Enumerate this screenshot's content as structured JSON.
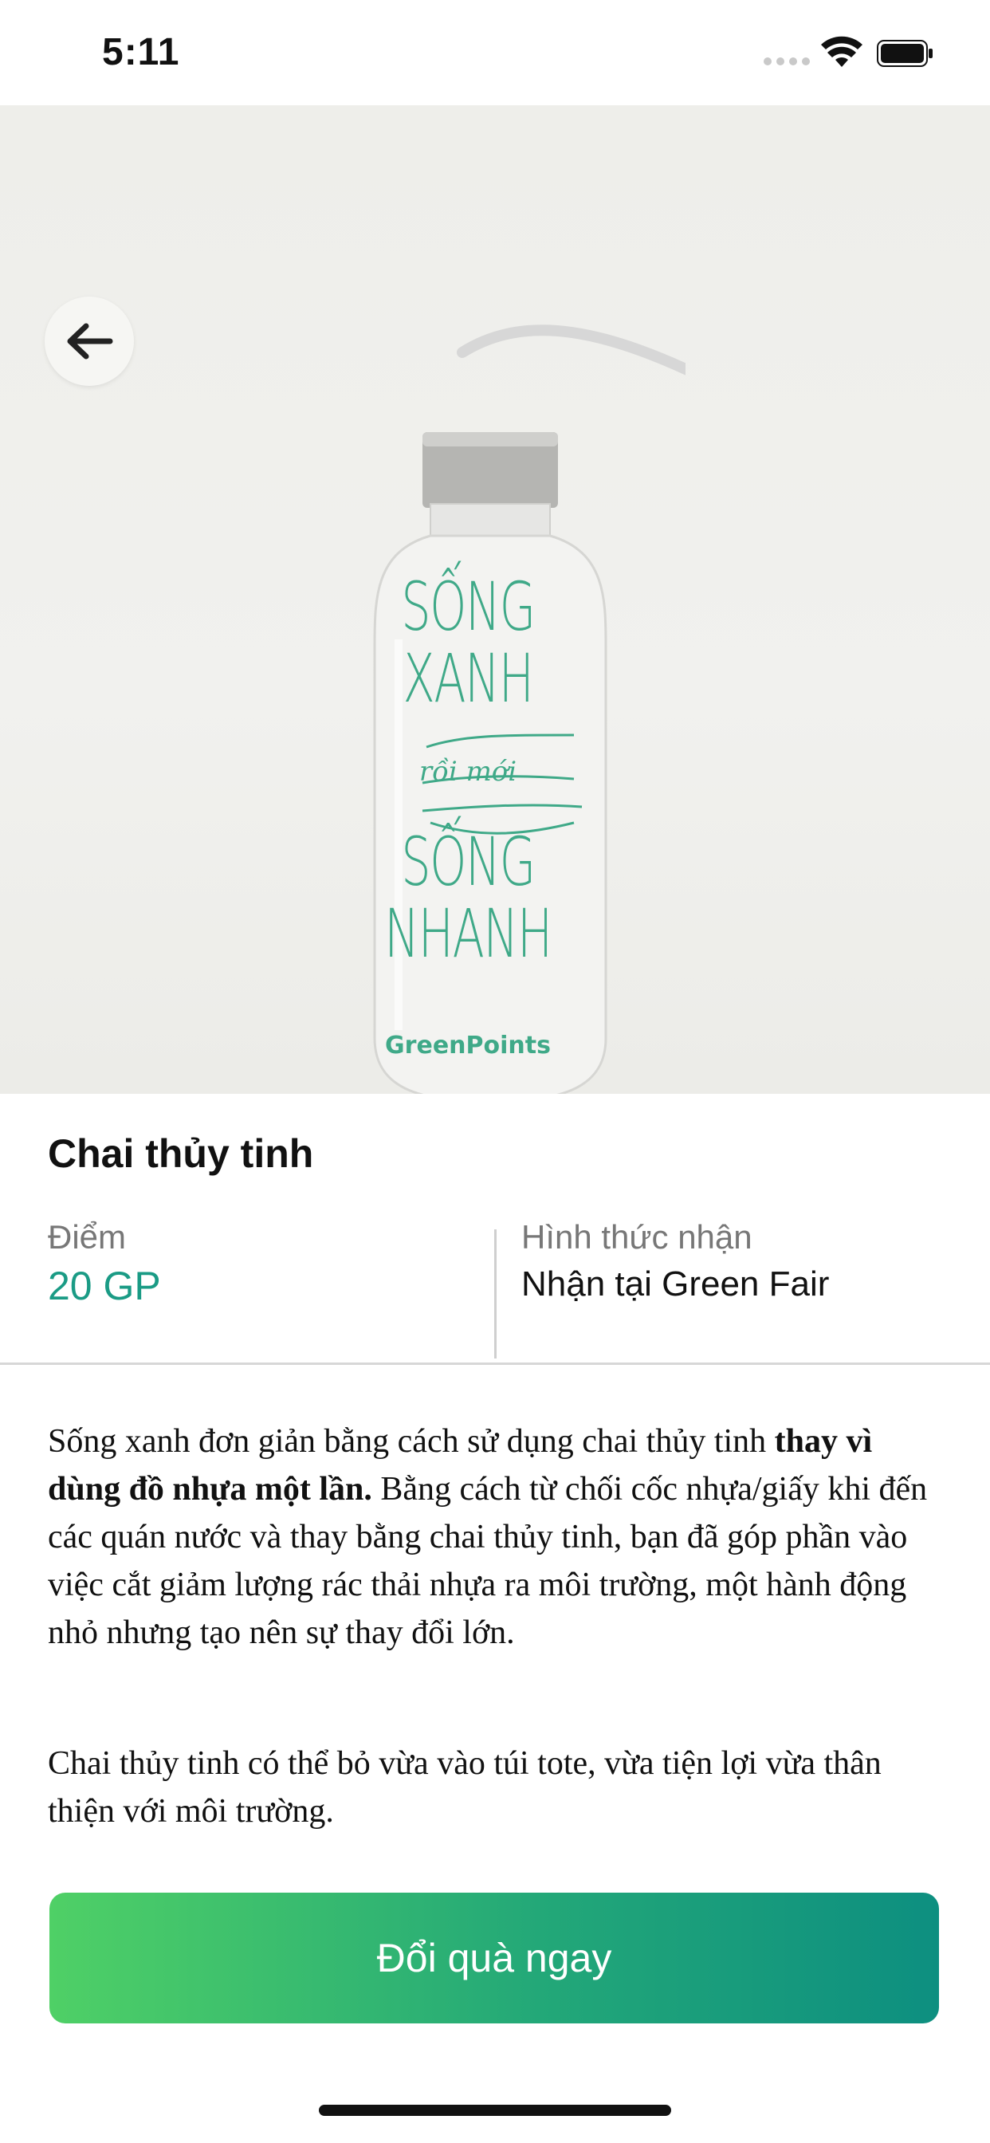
{
  "status_bar": {
    "time": "5:11"
  },
  "product": {
    "title": "Chai thủy tinh",
    "points_label": "Điểm",
    "points_value": "20 GP",
    "receive_label": "Hình thức nhận",
    "receive_value": "Nhận tại Green Fair",
    "bottle_print": {
      "line1": "SỐNG",
      "line2": "XANH",
      "line3": "rồi mới",
      "line4": "SỐNG",
      "line5": "NHANH",
      "logo": "GreenPoints"
    }
  },
  "description": {
    "p1_start": "Sống xanh đơn giản bằng cách sử dụng chai thủy tinh ",
    "p1_bold": "thay vì dùng đồ nhựa một lần.",
    "p1_rest": " Bằng cách từ chối cốc nhựa/giấy khi đến các quán nước và thay bằng chai thủy tinh, bạn đã góp phần vào việc cắt giảm lượng rác thải nhựa ra môi trường, một hành động nhỏ nhưng tạo nên sự thay đổi lớn.",
    "p2": "Chai thủy tinh có thể bỏ vừa vào túi tote, vừa tiện lợi vừa thân thiện với môi trường."
  },
  "cta": {
    "label": "Đổi quà ngay"
  },
  "colors": {
    "accent": "#1a9b85",
    "button_start": "#4fd066",
    "button_end": "#0d8f80"
  }
}
